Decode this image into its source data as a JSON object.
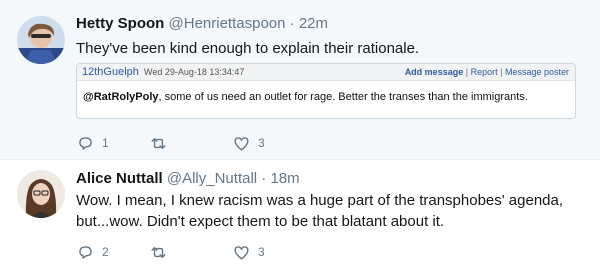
{
  "tweets": [
    {
      "display_name": "Hetty Spoon",
      "handle": "@Henriettaspoon",
      "separator": "·",
      "time": "22m",
      "text": "They've been kind enough to explain their rationale.",
      "quoted": {
        "user": "12thGuelph",
        "date": "Wed 29-Aug-18 13:34:47",
        "links": [
          "Add message",
          "Report",
          "Message poster"
        ],
        "mention": "@RatRolyPoly",
        "text": ", some of us need an outlet for rage. Better the transes than the immigrants."
      },
      "actions": {
        "replies": "1",
        "retweets": "",
        "likes": "3"
      }
    },
    {
      "display_name": "Alice Nuttall",
      "handle": "@Ally_Nuttall",
      "separator": "·",
      "time": "18m",
      "text_line1": "Wow. I mean, I knew racism was a huge part of the transphobes' agenda,",
      "text_line2": "but...wow. Didn't expect them to be that blatant about it.",
      "actions": {
        "replies": "2",
        "retweets": "",
        "likes": "3"
      }
    }
  ],
  "icons": {
    "reply": "reply-icon",
    "retweet": "retweet-icon",
    "like": "heart-icon"
  },
  "colors": {
    "action_gray": "#657786",
    "quote_link": "#2f5d9a",
    "tweet1_bg": "#f5f8fa"
  }
}
